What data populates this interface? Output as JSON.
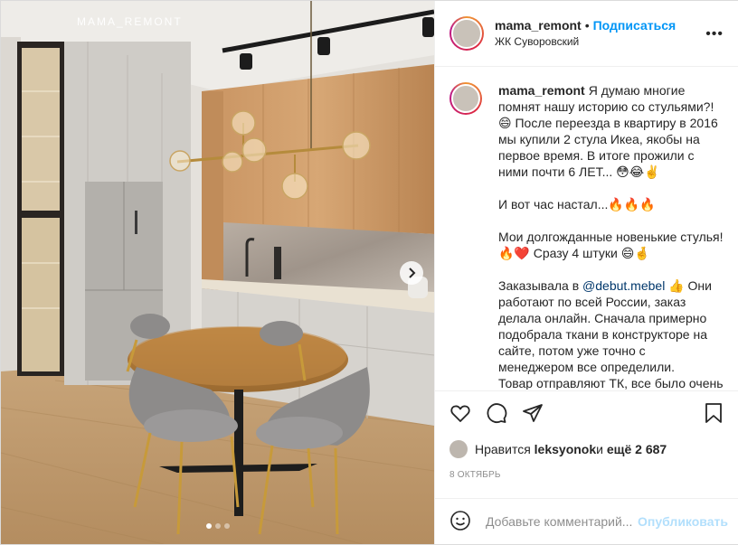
{
  "media": {
    "watermark": "MAMA_REMONT",
    "carousel_total": 3,
    "carousel_active": 1
  },
  "header": {
    "username": "mama_remont",
    "separator": "•",
    "follow_label": "Подписаться",
    "location": "ЖК Суворовский",
    "more_icon": "more-horizontal-icon"
  },
  "caption": {
    "username": "mama_remont",
    "paragraphs": [
      "Я думаю многие помнят нашу историю со стульями?! 😄 После переезда в квартиру в 2016 мы купили 2 стула Икеа, якобы на первое время. В итоге прожили с ними почти 6 ЛЕТ... 😳😂✌️",
      "И вот час настал...🔥🔥🔥",
      "Мои долгожданные новенькие стулья! 🔥❤️ Сразу 4 штуки 😄🤞"
    ],
    "order_prefix": "Заказывала в ",
    "mention": "@debut.mebel",
    "order_suffix": " 👍 Они работают по всей России, заказ делала онлайн. Сначала примерно подобрала ткани в конструкторе на сайте, потом уже точно с менеджером все определили.",
    "cut_line": "Товар отправляют ТК, все было очень"
  },
  "actions": {
    "icons": [
      "heart-icon",
      "comment-icon",
      "share-icon",
      "bookmark-icon"
    ]
  },
  "likes": {
    "prefix": "Нравится ",
    "user": "leksyonok",
    "middle": " и ",
    "count": "ещё 2 687"
  },
  "date": "8 ОКТЯБРЬ",
  "comment": {
    "placeholder": "Добавьте комментарий...",
    "publish_label": "Опубликовать"
  },
  "colors": {
    "accent": "#0095f6",
    "mention": "#00376b",
    "publish_disabled": "#b2dffc",
    "secondary_text": "#8e8e8e",
    "border": "#efefef"
  }
}
